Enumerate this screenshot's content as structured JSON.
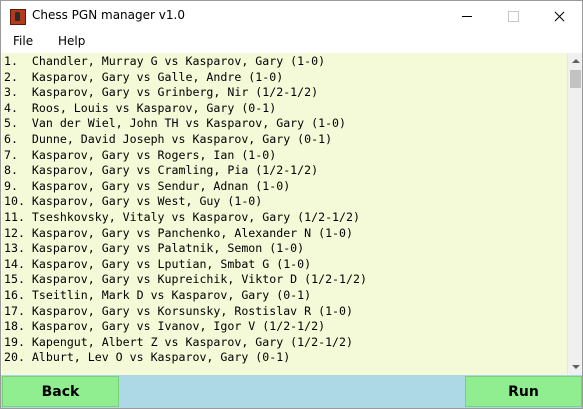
{
  "window": {
    "title": "Chess PGN manager v1.0"
  },
  "menu": {
    "file": "File",
    "help": "Help"
  },
  "games": [
    "1.  Chandler, Murray G vs Kasparov, Gary (1-0)",
    "2.  Kasparov, Gary vs Galle, Andre (1-0)",
    "3.  Kasparov, Gary vs Grinberg, Nir (1/2-1/2)",
    "4.  Roos, Louis vs Kasparov, Gary (0-1)",
    "5.  Van der Wiel, John TH vs Kasparov, Gary (1-0)",
    "6.  Dunne, David Joseph vs Kasparov, Gary (0-1)",
    "7.  Kasparov, Gary vs Rogers, Ian (1-0)",
    "8.  Kasparov, Gary vs Cramling, Pia (1/2-1/2)",
    "9.  Kasparov, Gary vs Sendur, Adnan (1-0)",
    "10. Kasparov, Gary vs West, Guy (1-0)",
    "11. Tseshkovsky, Vitaly vs Kasparov, Gary (1/2-1/2)",
    "12. Kasparov, Gary vs Panchenko, Alexander N (1-0)",
    "13. Kasparov, Gary vs Palatnik, Semon (1-0)",
    "14. Kasparov, Gary vs Lputian, Smbat G (1-0)",
    "15. Kasparov, Gary vs Kupreichik, Viktor D (1/2-1/2)",
    "16. Tseitlin, Mark D vs Kasparov, Gary (0-1)",
    "17. Kasparov, Gary vs Korsunsky, Rostislav R (1-0)",
    "18. Kasparov, Gary vs Ivanov, Igor V (1/2-1/2)",
    "19. Kapengut, Albert Z vs Kasparov, Gary (1/2-1/2)",
    "20. Alburt, Lev O vs Kasparov, Gary (0-1)"
  ],
  "buttons": {
    "back": "Back",
    "run": "Run"
  },
  "colors": {
    "list_background": "#f4fad8",
    "button_green": "#90ee90",
    "status_bar_blue": "#add8e6"
  },
  "icons": {
    "app": "chess-piece-icon",
    "minimize": "minimize-icon",
    "maximize": "maximize-icon",
    "close": "close-icon"
  }
}
